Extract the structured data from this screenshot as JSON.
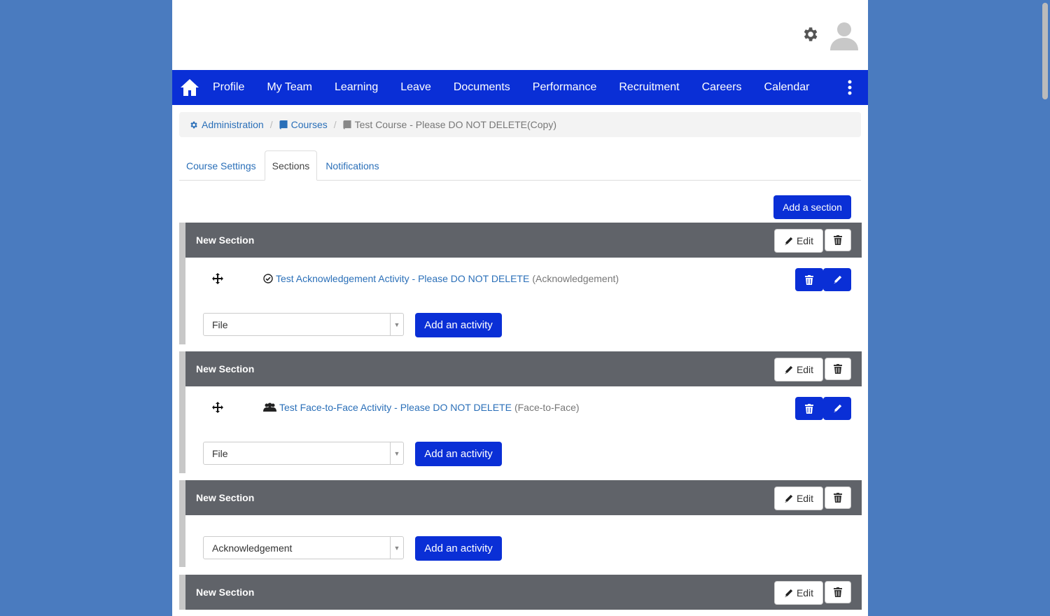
{
  "nav": {
    "items": [
      "Profile",
      "My Team",
      "Learning",
      "Leave",
      "Documents",
      "Performance",
      "Recruitment",
      "Careers",
      "Calendar"
    ]
  },
  "breadcrumb": {
    "administration": "Administration",
    "courses": "Courses",
    "current": "Test Course - Please DO NOT DELETE(Copy)"
  },
  "tabs": [
    "Course Settings",
    "Sections",
    "Notifications"
  ],
  "active_tab": "Sections",
  "add_section_label": "Add a section",
  "edit_label": "Edit",
  "add_activity_label": "Add an activity",
  "sections": [
    {
      "title": "New Section",
      "activity": {
        "icon": "check-circle-icon",
        "name": "Test Acknowledgement Activity - Please DO NOT DELETE",
        "type": "(Acknowledgement)"
      },
      "select_value": "File"
    },
    {
      "title": "New Section",
      "activity": {
        "icon": "users-icon",
        "name": "Test Face-to-Face Activity - Please DO NOT DELETE",
        "type": "(Face-to-Face)"
      },
      "select_value": "File"
    },
    {
      "title": "New Section",
      "select_value": "Acknowledgement"
    },
    {
      "title": "New Section"
    }
  ],
  "colors": {
    "nav_bg": "#0a2fd6",
    "section_header_bg": "#606369",
    "link": "#2a6fb8",
    "page_bg": "#4a7bbf"
  }
}
